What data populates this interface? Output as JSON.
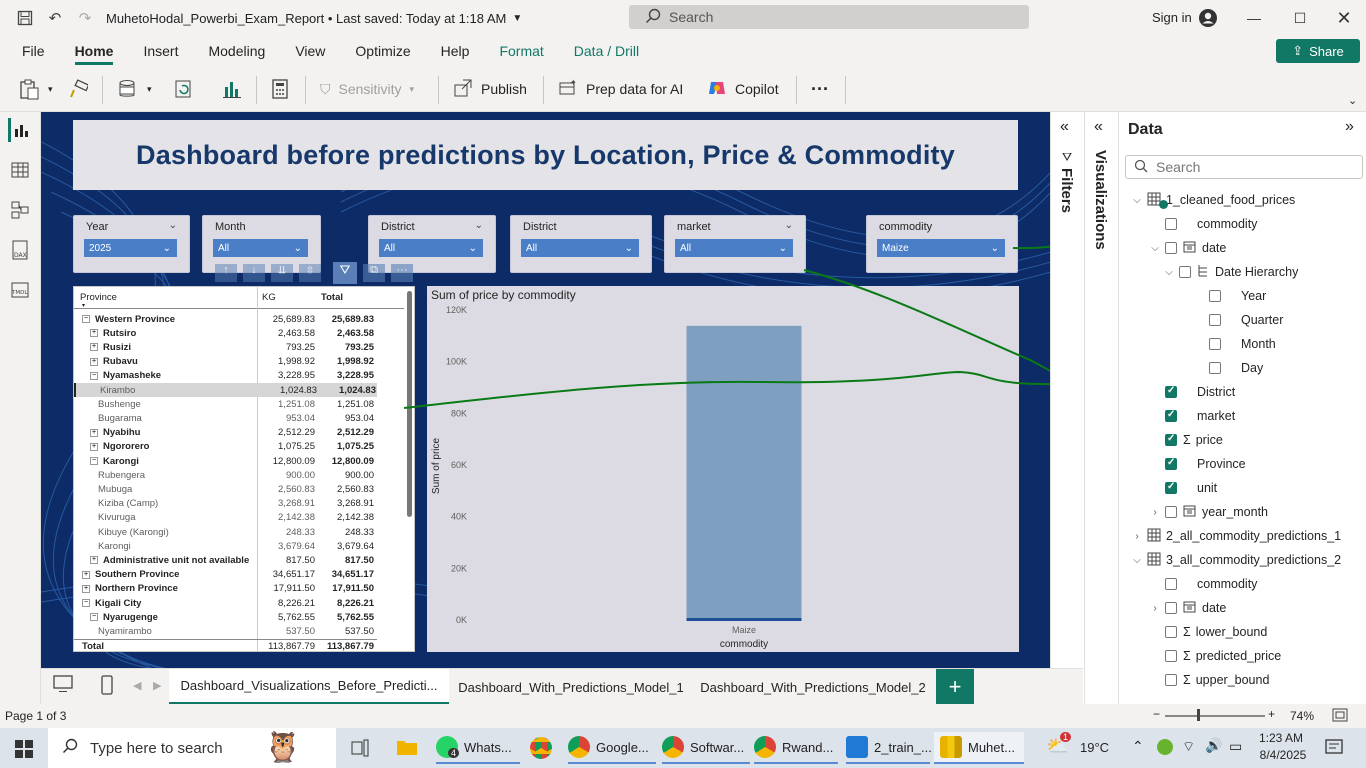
{
  "titlebar": {
    "doc_title": "MuhetoHodal_Powerbi_Exam_Report • Last saved: Today at 1:18 AM",
    "search_placeholder": "Search",
    "signin": "Sign in"
  },
  "menu": {
    "tabs": [
      "File",
      "Home",
      "Insert",
      "Modeling",
      "View",
      "Optimize",
      "Help",
      "Format",
      "Data / Drill"
    ],
    "active": "Home",
    "share": "Share"
  },
  "ribbon": {
    "sensitivity": "Sensitivity",
    "publish": "Publish",
    "prep_data": "Prep data for AI",
    "copilot": "Copilot",
    "more": "···"
  },
  "report": {
    "title": "Dashboard before predictions by Location, Price & Commodity",
    "slicers": [
      {
        "label": "Year",
        "value": "2025"
      },
      {
        "label": "Month",
        "value": "All"
      },
      {
        "label": "District",
        "value": "All"
      },
      {
        "label": "District",
        "value": "All"
      },
      {
        "label": "market",
        "value": "All"
      },
      {
        "label": "commodity",
        "value": "Maize"
      }
    ],
    "matrix": {
      "headers": {
        "col1": "Province",
        "col2": "KG",
        "col3": "Total"
      },
      "rows": [
        {
          "name": "Western Province",
          "kg": "25,689.83",
          "total": "25,689.83",
          "level": 0,
          "exp": "⊟",
          "bold": true
        },
        {
          "name": "Rutsiro",
          "kg": "2,463.58",
          "total": "2,463.58",
          "level": 1,
          "exp": "⊞",
          "bold": true
        },
        {
          "name": "Rusizi",
          "kg": "793.25",
          "total": "793.25",
          "level": 1,
          "exp": "⊞",
          "bold": true
        },
        {
          "name": "Rubavu",
          "kg": "1,998.92",
          "total": "1,998.92",
          "level": 1,
          "exp": "⊞",
          "bold": true
        },
        {
          "name": "Nyamasheke",
          "kg": "3,228.95",
          "total": "3,228.95",
          "level": 1,
          "exp": "⊟",
          "bold": true
        },
        {
          "name": "Kirambo",
          "kg": "1,024.83",
          "total": "1,024.83",
          "level": 2,
          "exp": "",
          "bold": false,
          "selected": true
        },
        {
          "name": "Bushenge",
          "kg": "1,251.08",
          "total": "1,251.08",
          "level": 2,
          "exp": "",
          "bold": false
        },
        {
          "name": "Bugarama",
          "kg": "953.04",
          "total": "953.04",
          "level": 2,
          "exp": "",
          "bold": false
        },
        {
          "name": "Nyabihu",
          "kg": "2,512.29",
          "total": "2,512.29",
          "level": 1,
          "exp": "⊞",
          "bold": true
        },
        {
          "name": "Ngororero",
          "kg": "1,075.25",
          "total": "1,075.25",
          "level": 1,
          "exp": "⊞",
          "bold": true
        },
        {
          "name": "Karongi",
          "kg": "12,800.09",
          "total": "12,800.09",
          "level": 1,
          "exp": "⊟",
          "bold": true
        },
        {
          "name": "Rubengera",
          "kg": "900.00",
          "total": "900.00",
          "level": 2,
          "exp": "",
          "bold": false
        },
        {
          "name": "Mubuga",
          "kg": "2,560.83",
          "total": "2,560.83",
          "level": 2,
          "exp": "",
          "bold": false
        },
        {
          "name": "Kiziba (Camp)",
          "kg": "3,268.91",
          "total": "3,268.91",
          "level": 2,
          "exp": "",
          "bold": false
        },
        {
          "name": "Kivuruga",
          "kg": "2,142.38",
          "total": "2,142.38",
          "level": 2,
          "exp": "",
          "bold": false
        },
        {
          "name": "Kibuye (Karongi)",
          "kg": "248.33",
          "total": "248.33",
          "level": 2,
          "exp": "",
          "bold": false
        },
        {
          "name": "Karongi",
          "kg": "3,679.64",
          "total": "3,679.64",
          "level": 2,
          "exp": "",
          "bold": false
        },
        {
          "name": "Administrative unit not available",
          "kg": "817.50",
          "total": "817.50",
          "level": 1,
          "exp": "⊞",
          "bold": true
        },
        {
          "name": "Southern Province",
          "kg": "34,651.17",
          "total": "34,651.17",
          "level": 0,
          "exp": "⊞",
          "bold": true
        },
        {
          "name": "Northern Province",
          "kg": "17,911.50",
          "total": "17,911.50",
          "level": 0,
          "exp": "⊞",
          "bold": true
        },
        {
          "name": "Kigali City",
          "kg": "8,226.21",
          "total": "8,226.21",
          "level": 0,
          "exp": "⊟",
          "bold": true
        },
        {
          "name": "Nyarugenge",
          "kg": "5,762.55",
          "total": "5,762.55",
          "level": 1,
          "exp": "⊟",
          "bold": true
        },
        {
          "name": "Nyamirambo",
          "kg": "537.50",
          "total": "537.50",
          "level": 2,
          "exp": "",
          "bold": false
        },
        {
          "name": "Total",
          "kg": "113,867.79",
          "total": "113,867.79",
          "level": 0,
          "exp": "",
          "bold": true
        }
      ]
    }
  },
  "chart_data": {
    "type": "bar",
    "title": "Sum of price by commodity",
    "categories": [
      "Maize"
    ],
    "values": [
      113867.79
    ],
    "xlabel": "commodity",
    "ylabel": "Sum of price",
    "ylim": [
      0,
      120000
    ],
    "yticks": [
      "0K",
      "20K",
      "40K",
      "60K",
      "80K",
      "100K",
      "120K"
    ],
    "grid": false,
    "bar_color": "#7f9fc0"
  },
  "panes": {
    "filters": "Filters",
    "visualizations": "Visualizations",
    "data_title": "Data",
    "data_search": "Search",
    "fields": [
      {
        "label": "1_cleaned_food_prices",
        "kind": "table",
        "chev": "open",
        "indent": 0
      },
      {
        "label": "commodity",
        "kind": "field",
        "checked": false,
        "indent": 1
      },
      {
        "label": "date",
        "kind": "date",
        "checked": false,
        "indent": 1,
        "chev": "open"
      },
      {
        "label": "Date Hierarchy",
        "kind": "hier",
        "checked": false,
        "indent": 2,
        "chev": "open"
      },
      {
        "label": "Year",
        "kind": "field",
        "checked": false,
        "indent": 3
      },
      {
        "label": "Quarter",
        "kind": "field",
        "checked": false,
        "indent": 3
      },
      {
        "label": "Month",
        "kind": "field",
        "checked": false,
        "indent": 3
      },
      {
        "label": "Day",
        "kind": "field",
        "checked": false,
        "indent": 3
      },
      {
        "label": "District",
        "kind": "field",
        "checked": true,
        "indent": 1
      },
      {
        "label": "market",
        "kind": "field",
        "checked": true,
        "indent": 1
      },
      {
        "label": "price",
        "kind": "sum",
        "checked": true,
        "indent": 1
      },
      {
        "label": "Province",
        "kind": "field",
        "checked": true,
        "indent": 1
      },
      {
        "label": "unit",
        "kind": "field",
        "checked": true,
        "indent": 1
      },
      {
        "label": "year_month",
        "kind": "date",
        "checked": false,
        "indent": 1,
        "chev": "closed"
      },
      {
        "label": "2_all_commodity_predictions_1",
        "kind": "table",
        "chev": "closed",
        "indent": 0
      },
      {
        "label": "3_all_commodity_predictions_2",
        "kind": "table",
        "chev": "open",
        "indent": 0
      },
      {
        "label": "commodity",
        "kind": "field",
        "checked": false,
        "indent": 1
      },
      {
        "label": "date",
        "kind": "date",
        "checked": false,
        "indent": 1,
        "chev": "closed"
      },
      {
        "label": "lower_bound",
        "kind": "sum",
        "checked": false,
        "indent": 1
      },
      {
        "label": "predicted_price",
        "kind": "sum",
        "checked": false,
        "indent": 1
      },
      {
        "label": "upper_bound",
        "kind": "sum",
        "checked": false,
        "indent": 1
      }
    ]
  },
  "pages": {
    "tabs": [
      "Dashboard_Visualizations_Before_Predicti...",
      "Dashboard_With_Predictions_Model_1",
      "Dashboard_With_Predictions_Model_2"
    ],
    "active": 0,
    "add": "+"
  },
  "status": {
    "page": "Page 1 of 3",
    "zoom": "74%"
  },
  "taskbar": {
    "search_placeholder": "Type here to search",
    "apps": [
      "Whats...",
      "Google...",
      "Softwar...",
      "Rwand...",
      "2_train_...",
      "Muhet..."
    ],
    "whatsapp_badge": "4",
    "weather": "19°C",
    "weather_badge": "1",
    "time": "1:23 AM",
    "date": "8/4/2025"
  }
}
